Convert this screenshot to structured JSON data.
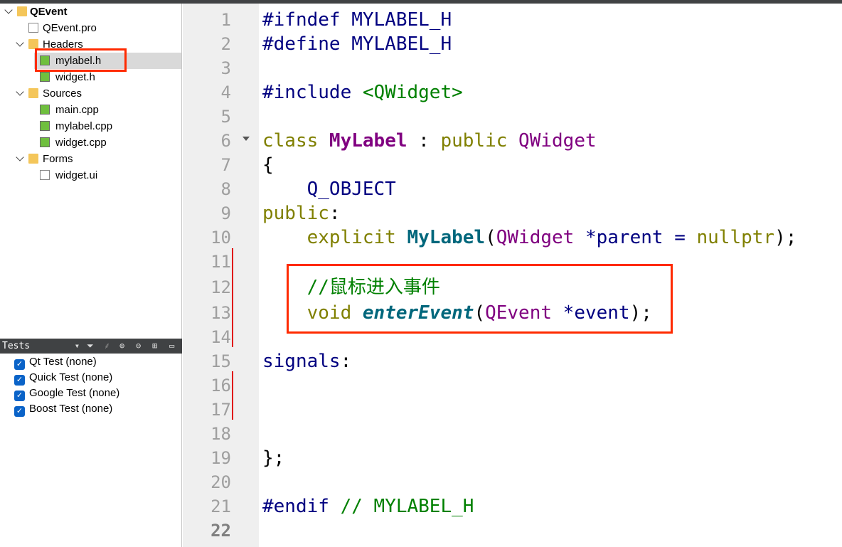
{
  "project_tree": {
    "project": "QEvent",
    "pro_file": "QEvent.pro",
    "headers": {
      "label": "Headers",
      "files": [
        "mylabel.h",
        "widget.h"
      ]
    },
    "sources": {
      "label": "Sources",
      "files": [
        "main.cpp",
        "mylabel.cpp",
        "widget.cpp"
      ]
    },
    "forms": {
      "label": "Forms",
      "files": [
        "widget.ui"
      ]
    },
    "selected": "mylabel.h"
  },
  "tests_panel": {
    "title": "Tests",
    "items": [
      {
        "label": "Qt Test (none)",
        "checked": true
      },
      {
        "label": "Quick Test (none)",
        "checked": true
      },
      {
        "label": "Google Test (none)",
        "checked": true
      },
      {
        "label": "Boost Test (none)",
        "checked": true
      }
    ]
  },
  "editor": {
    "current_line": 22,
    "lines": [
      [
        [
          "#ifndef MYLABEL_H",
          "pp"
        ]
      ],
      [
        [
          "#define MYLABEL_H",
          "pp"
        ]
      ],
      [],
      [
        [
          "#include ",
          "pp"
        ],
        [
          "<QWidget>",
          "str"
        ]
      ],
      [],
      [
        [
          "class ",
          "kw"
        ],
        [
          "MyLabel",
          "cls"
        ],
        [
          " : ",
          "pl"
        ],
        [
          "public ",
          "kw"
        ],
        [
          "QWidget",
          "type"
        ]
      ],
      [
        [
          "{",
          "pl"
        ]
      ],
      [
        [
          "    Q_OBJECT",
          "id"
        ]
      ],
      [
        [
          "public",
          "kw"
        ],
        [
          ":",
          "pl"
        ]
      ],
      [
        [
          "    explicit ",
          "kw"
        ],
        [
          "MyLabel",
          "fn"
        ],
        [
          "(",
          "pl"
        ],
        [
          "QWidget",
          "type"
        ],
        [
          " *parent = ",
          "id"
        ],
        [
          "nullptr",
          "kw"
        ],
        [
          ");",
          "pl"
        ]
      ],
      [],
      [
        [
          "    //鼠标进入事件",
          "cm"
        ]
      ],
      [
        [
          "    void ",
          "kw"
        ],
        [
          "enterEvent",
          "fni"
        ],
        [
          "(",
          "pl"
        ],
        [
          "QEvent",
          "type"
        ],
        [
          " *event",
          "id"
        ],
        [
          ");",
          "pl"
        ]
      ],
      [],
      [
        [
          "signals",
          "id"
        ],
        [
          ":",
          "pl"
        ]
      ],
      [],
      [],
      [],
      [
        [
          "};",
          "pl"
        ]
      ],
      [],
      [
        [
          "#endif ",
          "pp"
        ],
        [
          "// MYLABEL_H",
          "cm"
        ]
      ],
      []
    ]
  },
  "colors": {
    "annotation": "#ff2a00",
    "change_marker": "#e00000"
  }
}
